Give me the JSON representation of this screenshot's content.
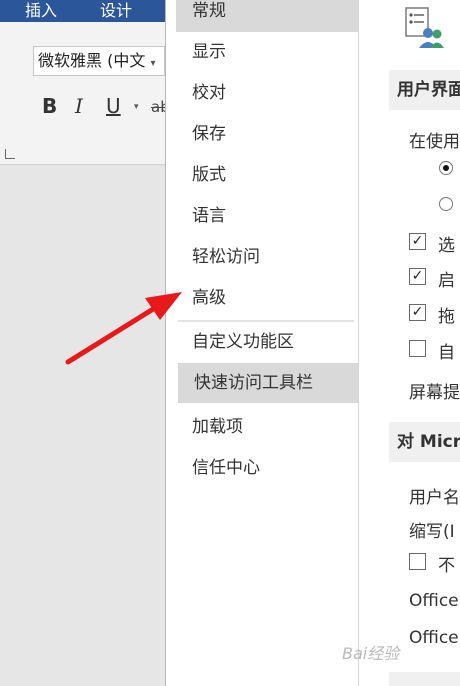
{
  "ribbon": {
    "tabs": [
      "插入",
      "设计"
    ],
    "font_name": "微软雅黑 (中文",
    "bold": "B",
    "italic": "I",
    "underline": "U",
    "strike_partial": "ab"
  },
  "nav": {
    "items": [
      {
        "label": "常规"
      },
      {
        "label": "显示"
      },
      {
        "label": "校对"
      },
      {
        "label": "保存"
      },
      {
        "label": "版式"
      },
      {
        "label": "语言"
      },
      {
        "label": "轻松访问"
      },
      {
        "label": "高级"
      },
      {
        "label": "自定义功能区"
      },
      {
        "label": "快速访问工具栏",
        "selected": true
      },
      {
        "label": "加载项"
      },
      {
        "label": "信任中心"
      }
    ]
  },
  "content": {
    "section1_header": "用户界面",
    "when_using": "在使用",
    "cb1": "选",
    "cb2": "启",
    "cb3": "拖",
    "cb4": "自",
    "screen_tip": "屏幕提",
    "section2_header": "对 Micr",
    "username": "用户名",
    "initials": "缩写(I",
    "cb5": "不",
    "office1": "Office",
    "office2": "Office"
  },
  "watermark": "Bai经验",
  "colors": {
    "ribbon_blue": "#2b579a",
    "arrow_red": "#e8191b",
    "selected_bg": "#d9d9d9"
  }
}
